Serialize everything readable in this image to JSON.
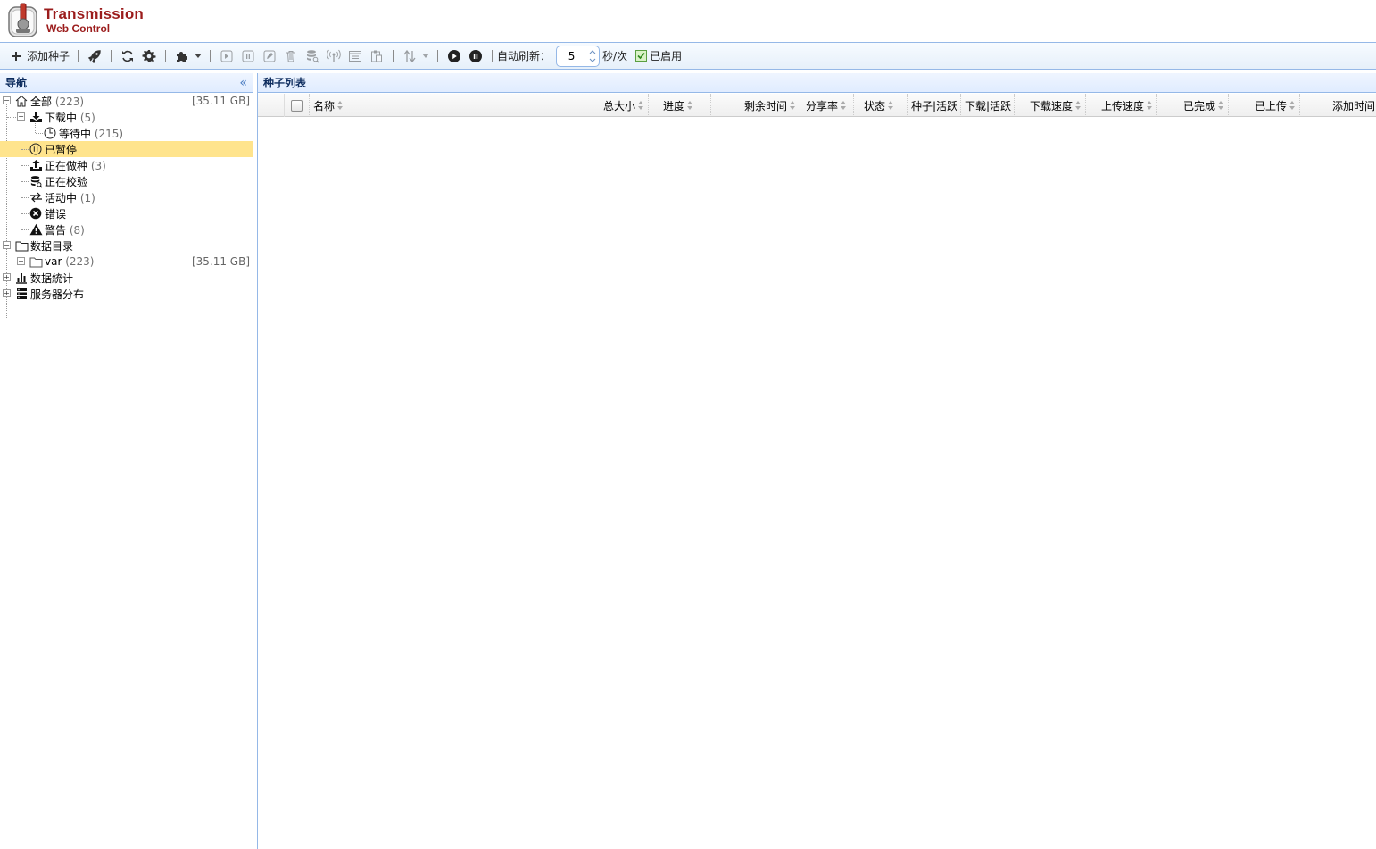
{
  "app": {
    "title_line1": "Transmission",
    "title_line2": "Web Control"
  },
  "toolbar": {
    "add_torrent": "添加种子",
    "auto_refresh_label": "自动刷新：",
    "refresh_interval": "5",
    "interval_unit": "秒/次",
    "enabled_label": "已启用",
    "enabled": true
  },
  "nav": {
    "title": "导航",
    "items": [
      {
        "label": "全部",
        "count": "(223)",
        "size": "[35.11 GB]"
      },
      {
        "label": "下载中",
        "count": "(5)"
      },
      {
        "label": "等待中",
        "count": "(215)"
      },
      {
        "label": "已暂停",
        "count": "",
        "selected": true
      },
      {
        "label": "正在做种",
        "count": "(3)"
      },
      {
        "label": "正在校验",
        "count": ""
      },
      {
        "label": "活动中",
        "count": "(1)"
      },
      {
        "label": "错误",
        "count": ""
      },
      {
        "label": "警告",
        "count": "(8)"
      },
      {
        "label": "数据目录",
        "count": ""
      },
      {
        "label": "var",
        "count": "(223)",
        "size": "[35.11 GB]"
      },
      {
        "label": "数据統计",
        "count": ""
      },
      {
        "label": "服务器分布",
        "count": ""
      }
    ]
  },
  "torrents": {
    "title": "种子列表",
    "columns": [
      "名称",
      "总大小",
      "进度",
      "剩余时间",
      "分享率",
      "状态",
      "种子|活跃",
      "下载|活跃",
      "下载速度",
      "上传速度",
      "已完成",
      "已上传",
      "添加时间"
    ],
    "rows": []
  },
  "colors": {
    "brand": "#9b1c1c",
    "border": "#95b8e7",
    "selected": "#ffe48d"
  }
}
